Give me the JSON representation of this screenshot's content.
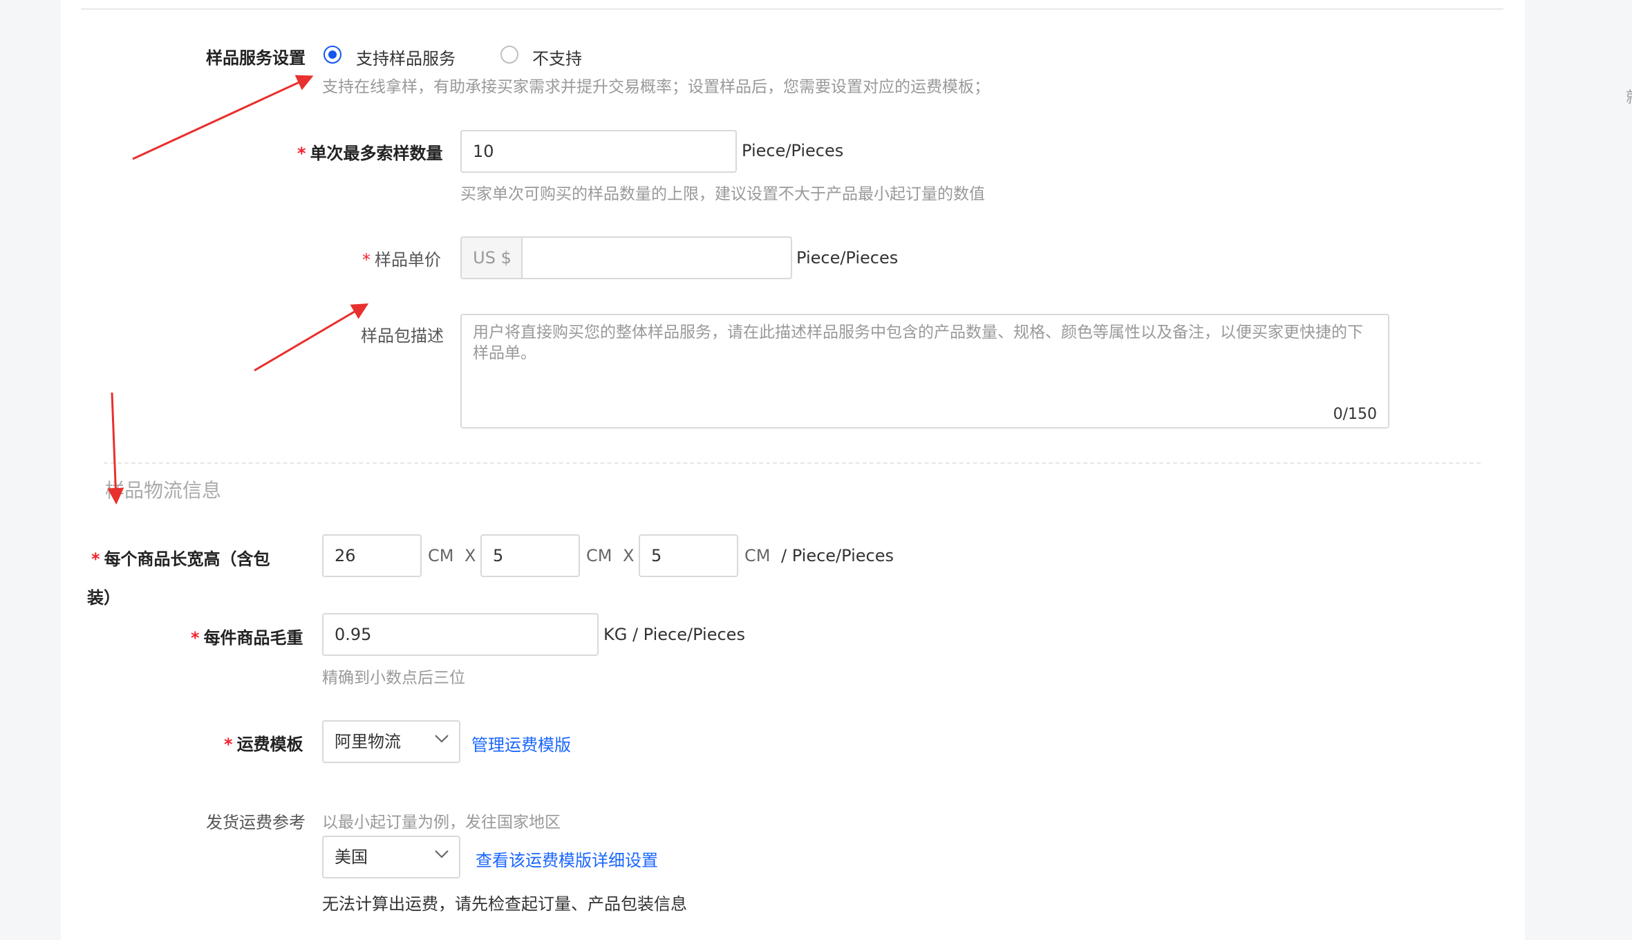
{
  "right_hint": "就",
  "sample_service": {
    "label": "样品服务设置",
    "option_support": "支持样品服务",
    "option_not_support": "不支持",
    "selected": "支持样品服务",
    "hint": "支持在线拿样，有助承接买家需求并提升交易概率；设置样品后，您需要设置对应的运费模板；"
  },
  "max_qty": {
    "label": "单次最多索样数量",
    "value": "10",
    "unit": "Piece/Pieces",
    "hint": "买家单次可购买的样品数量的上限，建议设置不大于产品最小起订量的数值"
  },
  "unit_price": {
    "label": "样品单价",
    "prefix": "US $",
    "value": "",
    "unit": "Piece/Pieces"
  },
  "package_desc": {
    "label": "样品包描述",
    "placeholder": "用户将直接购买您的整体样品服务，请在此描述样品服务中包含的产品数量、规格、颜色等属性以及备注，以便买家更快捷的下样品单。",
    "counter": "0/150"
  },
  "logistics_section": {
    "title": "样品物流信息"
  },
  "dimensions": {
    "label_line1": "每个商品长宽高（含包",
    "label_line2": "装）",
    "length": "26",
    "width": "5",
    "height": "5",
    "unit_cm": "CM",
    "times": "X",
    "suffix": "/ Piece/Pieces"
  },
  "weight": {
    "label": "每件商品毛重",
    "value": "0.95",
    "unit": "KG / Piece/Pieces",
    "hint": "精确到小数点后三位"
  },
  "shipping_template": {
    "label": "运费模板",
    "selected": "阿里物流",
    "manage_link": "管理运费模版"
  },
  "shipping_reference": {
    "label": "发货运费参考",
    "hint": "以最小起订量为例，发往国家地区",
    "country": "美国",
    "detail_link": "查看该运费模版详细设置",
    "error": "无法计算出运费，请先检查起订量、产品包装信息"
  },
  "colors": {
    "accent": "#1456f0",
    "link": "#1a66ff",
    "required": "#f5222d",
    "annotation_arrow": "#e8302e"
  }
}
